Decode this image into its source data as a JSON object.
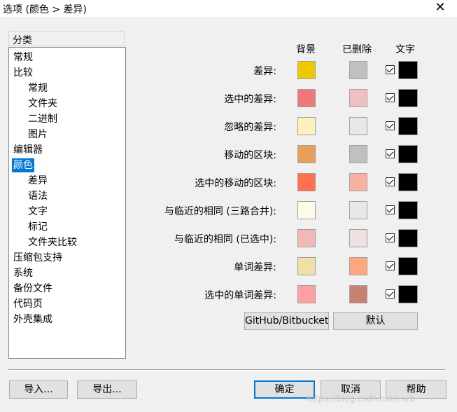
{
  "window": {
    "title": "选项 (颜色 > 差异)",
    "close_glyph": "✕"
  },
  "categories": {
    "header": "分类",
    "items": [
      {
        "label": "常规",
        "level": 0
      },
      {
        "label": "比较",
        "level": 0
      },
      {
        "label": "常规",
        "level": 1
      },
      {
        "label": "文件夹",
        "level": 1
      },
      {
        "label": "二进制",
        "level": 1
      },
      {
        "label": "图片",
        "level": 1
      },
      {
        "label": "编辑器",
        "level": 0
      },
      {
        "label": "颜色",
        "level": 0,
        "selected": true
      },
      {
        "label": "差异",
        "level": 1
      },
      {
        "label": "语法",
        "level": 1
      },
      {
        "label": "文字",
        "level": 1
      },
      {
        "label": "标记",
        "level": 1
      },
      {
        "label": "文件夹比较",
        "level": 1
      },
      {
        "label": "压缩包支持",
        "level": 0
      },
      {
        "label": "系统",
        "level": 0
      },
      {
        "label": "备份文件",
        "level": 0
      },
      {
        "label": "代码页",
        "level": 0
      },
      {
        "label": "外壳集成",
        "level": 0
      }
    ]
  },
  "colors": {
    "headers": {
      "background": "背景",
      "deleted": "已删除",
      "text": "文字"
    },
    "rows": [
      {
        "label": "差异:",
        "bg": "#f0c800",
        "del": "#c0c0c0",
        "checked": true,
        "text": "#000000"
      },
      {
        "label": "选中的差异:",
        "bg": "#f07878",
        "del": "#f0c0c0",
        "checked": true,
        "text": "#000000"
      },
      {
        "label": "忽略的差异:",
        "bg": "#fff0c0",
        "del": "#e8e8e8",
        "checked": true,
        "text": "#000000"
      },
      {
        "label": "移动的区块:",
        "bg": "#e8a058",
        "del": "#c0c0c0",
        "checked": true,
        "text": "#000000"
      },
      {
        "label": "选中的移动的区块:",
        "bg": "#ff7050",
        "del": "#f8b0a0",
        "checked": true,
        "text": "#000000"
      },
      {
        "label": "与临近的相同 (三路合并):",
        "bg": "#fffae8",
        "del": "#e8e8e8",
        "checked": true,
        "text": "#000000"
      },
      {
        "label": "与临近的相同 (已选中):",
        "bg": "#f0b8b8",
        "del": "#f0e0e0",
        "checked": true,
        "text": "#000000"
      },
      {
        "label": "单词差异:",
        "bg": "#f0e0a8",
        "del": "#ffa880",
        "checked": true,
        "text": "#000000"
      },
      {
        "label": "选中的单词差异:",
        "bg": "#ffa0a0",
        "del": "#c88070",
        "checked": true,
        "text": "#000000"
      }
    ],
    "github_button": "GitHub/Bitbucket",
    "default_button": "默认"
  },
  "footer": {
    "import": "导入...",
    "export": "导出...",
    "ok": "确定",
    "cancel": "取消",
    "help": "帮助"
  },
  "watermark": "https://blog.csdn.net/cszb"
}
